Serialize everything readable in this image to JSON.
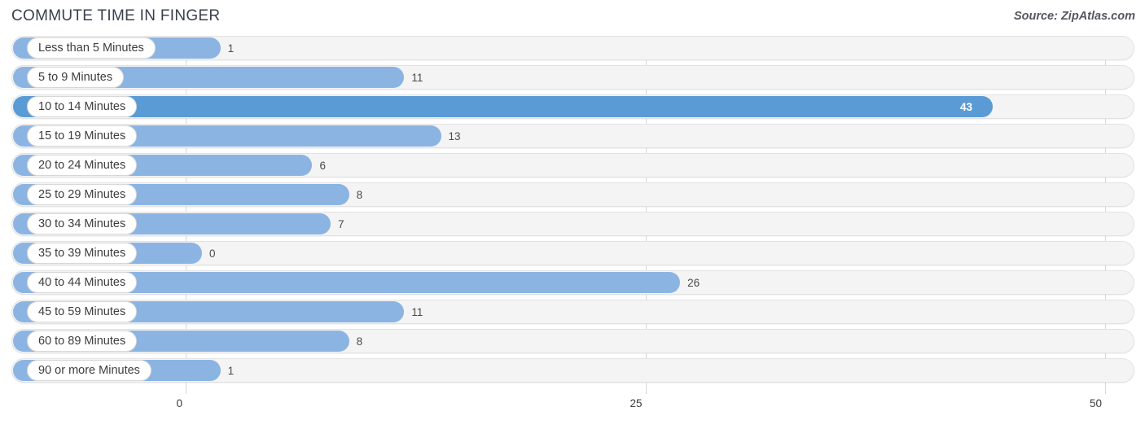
{
  "header": {
    "title": "COMMUTE TIME IN FINGER",
    "source": "Source: ZipAtlas.com"
  },
  "chart_data": {
    "type": "bar",
    "orientation": "horizontal",
    "title": "COMMUTE TIME IN FINGER",
    "xlabel": "",
    "ylabel": "",
    "xlim": [
      0,
      50
    ],
    "ticks": [
      {
        "label": "0",
        "value": 0
      },
      {
        "label": "25",
        "value": 25
      },
      {
        "label": "50",
        "value": 50
      }
    ],
    "grid": true,
    "legend": null,
    "highlight_color": "#5b9bd5",
    "bar_color": "#8cb4e2",
    "categories": [
      "Less than 5 Minutes",
      "5 to 9 Minutes",
      "10 to 14 Minutes",
      "15 to 19 Minutes",
      "20 to 24 Minutes",
      "25 to 29 Minutes",
      "30 to 34 Minutes",
      "35 to 39 Minutes",
      "40 to 44 Minutes",
      "45 to 59 Minutes",
      "60 to 89 Minutes",
      "90 or more Minutes"
    ],
    "values": [
      1,
      11,
      43,
      13,
      6,
      8,
      7,
      0,
      26,
      11,
      8,
      1
    ],
    "value_labels": [
      "1",
      "11",
      "43",
      "13",
      "6",
      "8",
      "7",
      "0",
      "26",
      "11",
      "8",
      "1"
    ],
    "max_value": 43
  }
}
